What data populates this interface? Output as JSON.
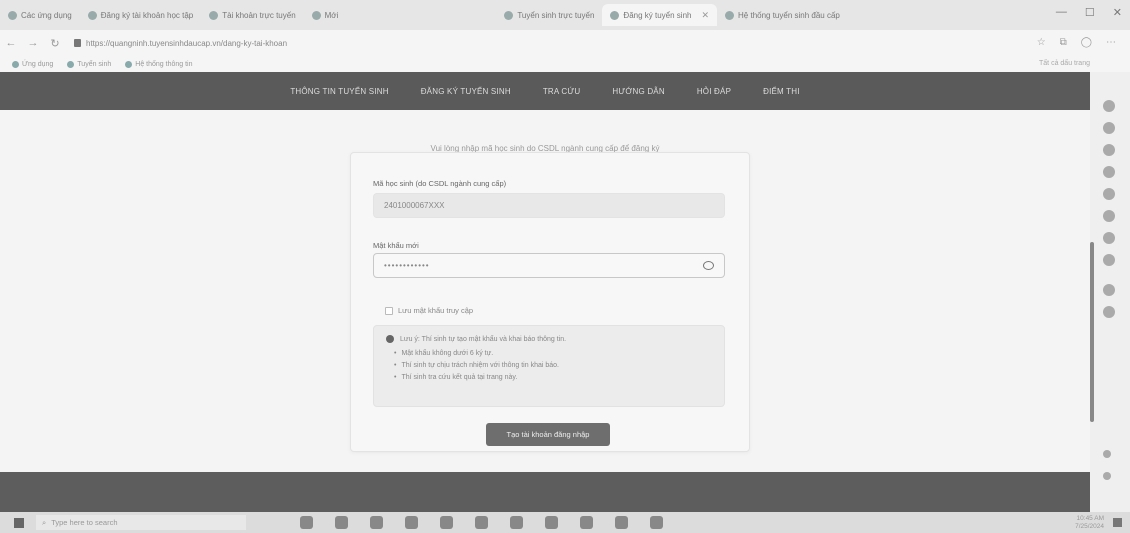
{
  "browser": {
    "tabs": [
      {
        "label": "Các ứng dụng"
      },
      {
        "label": "Đăng ký tài khoản học tập"
      },
      {
        "label": "Tài khoản trực tuyến"
      },
      {
        "label": "Mới"
      },
      {
        "label": "Tuyển sinh trực tuyến"
      },
      {
        "label": "Đăng ký tuyển sinh",
        "active": true
      },
      {
        "label": "Hệ thống tuyển sinh đầu cấp"
      }
    ],
    "url": "https://quangninh.tuyensinhdaucap.vn/dang-ky-tai-khoan",
    "bookmarks": [
      "Ứng dụng",
      "Tuyển sinh",
      "Hệ thống thông tin"
    ],
    "bookmarks_right": "Tất cả dấu trang"
  },
  "site_nav": {
    "items": [
      "Thông tin tuyển sinh",
      "Đăng ký tuyển sinh",
      "Tra cứu",
      "Hướng dẫn",
      "Hỏi đáp",
      "Điểm thi"
    ]
  },
  "main": {
    "notice": "Vui lòng nhập mã học sinh do CSDL ngành cung cấp để đăng ký"
  },
  "form": {
    "username_label": "Mã học sinh (do CSDL ngành cung cấp)",
    "username_value": "2401000067XXX",
    "password_label": "Mật khẩu mới",
    "password_value": "••••••••••••",
    "remember_label": "Lưu mật khẩu truy cập",
    "info_title": "Lưu ý: Thí sinh tự tạo mật khẩu và khai báo thông tin.",
    "info_items": [
      "Mật khẩu không dưới 6 ký tự.",
      "Thí sinh tự chịu trách nhiệm với thông tin khai báo.",
      "Thí sinh tra cứu kết quả tại trang này."
    ],
    "submit_label": "Tạo tài khoản đăng nhập"
  },
  "taskbar": {
    "search_placeholder": "Type here to search",
    "time": "10:45 AM",
    "date": "7/25/2024"
  }
}
